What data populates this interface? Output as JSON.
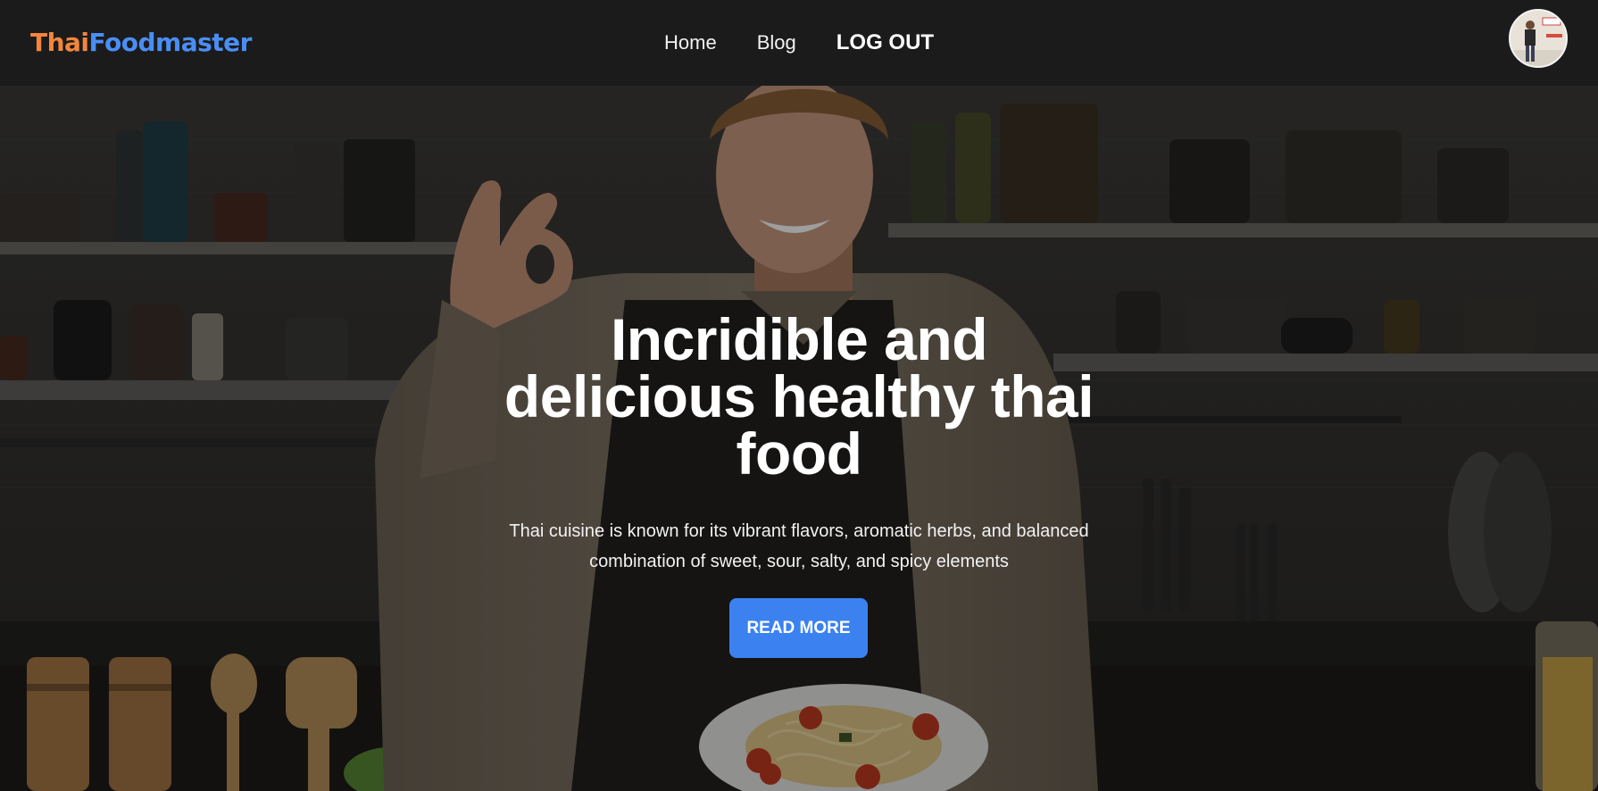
{
  "header": {
    "logo": {
      "part1": "Thai",
      "part2": "Foodmaster"
    },
    "nav": {
      "home": "Home",
      "blog": "Blog",
      "logout": "LOG OUT"
    },
    "avatar_icon": "user-avatar-photo"
  },
  "hero": {
    "title": "Incridible and delicious healthy thai food",
    "subtitle": "Thai cuisine is known for its vibrant flavors, aromatic herbs, and balanced combination of sweet, sour, salty, and spicy elements",
    "cta_label": "READ MORE"
  },
  "colors": {
    "navbar_bg": "#1b1b1b",
    "logo_thai": "#f2863c",
    "logo_foodmaster": "#4a8ef5",
    "cta_bg": "#3b82f0"
  }
}
